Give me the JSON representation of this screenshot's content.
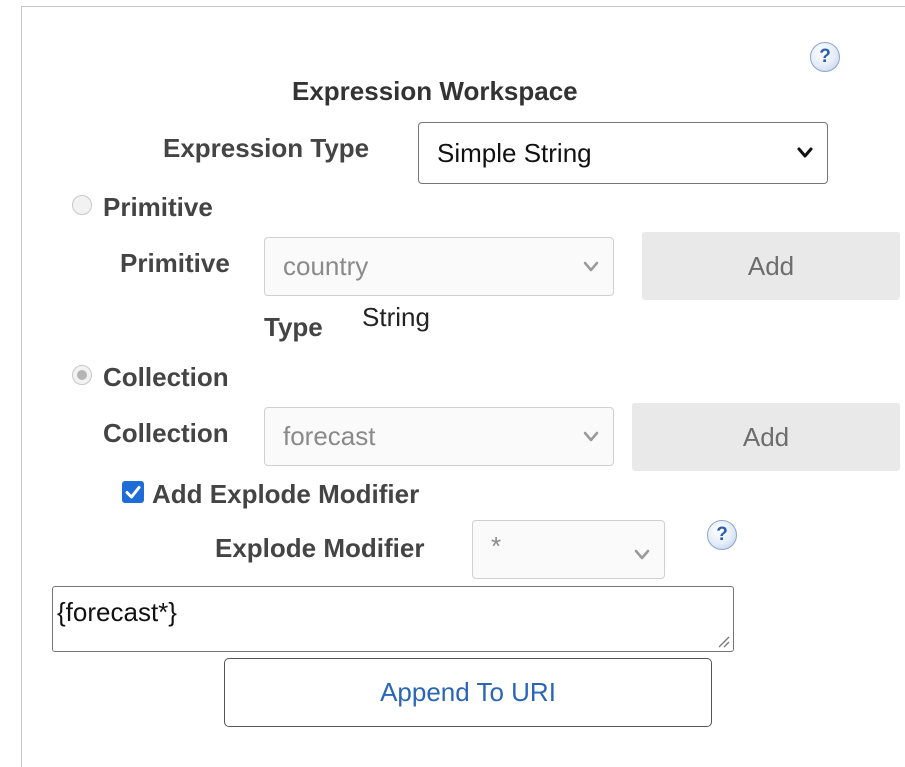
{
  "workspace": {
    "title": "Expression Workspace",
    "help_glyph": "?",
    "expression_type": {
      "label": "Expression Type",
      "value": "Simple String"
    },
    "primitive": {
      "radio_label": "Primitive",
      "field_label": "Primitive",
      "value": "country",
      "add_label": "Add",
      "type_label": "Type",
      "type_value": "String"
    },
    "collection": {
      "radio_label": "Collection",
      "field_label": "Collection",
      "value": "forecast",
      "add_label": "Add"
    },
    "explode": {
      "checkbox_label": "Add Explode Modifier",
      "field_label": "Explode Modifier",
      "value": "*"
    },
    "expression_text": "{forecast*}",
    "append_label": "Append To URI"
  },
  "colors": {
    "help_icon": "#2a5db0",
    "checkbox": "#1e6cd8",
    "link_text": "#2a66b8",
    "disabled_button": "#e9e9e9"
  },
  "state": {
    "primitive_selected": false,
    "collection_selected": true,
    "explode_checked": true
  }
}
